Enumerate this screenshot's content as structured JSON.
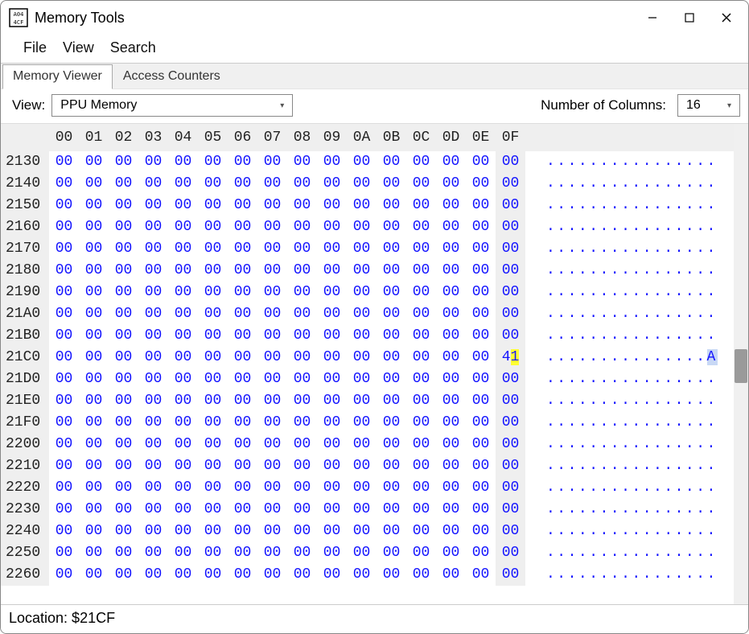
{
  "window": {
    "title": "Memory Tools"
  },
  "menubar": {
    "items": [
      "File",
      "View",
      "Search"
    ]
  },
  "tabs": {
    "items": [
      {
        "label": "Memory Viewer",
        "active": true
      },
      {
        "label": "Access Counters",
        "active": false
      }
    ]
  },
  "toolbar": {
    "view_label": "View:",
    "view_value": "PPU Memory",
    "cols_label": "Number of Columns:",
    "cols_value": "16"
  },
  "hex": {
    "col_headers": [
      "00",
      "01",
      "02",
      "03",
      "04",
      "05",
      "06",
      "07",
      "08",
      "09",
      "0A",
      "0B",
      "0C",
      "0D",
      "0E",
      "0F"
    ],
    "cursor": {
      "row_index": 9,
      "col_index": 15,
      "byte": "41",
      "sel_char_pos": 1,
      "ascii_char": "A"
    },
    "rows": [
      {
        "addr": "2130",
        "bytes": [
          "00",
          "00",
          "00",
          "00",
          "00",
          "00",
          "00",
          "00",
          "00",
          "00",
          "00",
          "00",
          "00",
          "00",
          "00",
          "00"
        ],
        "ascii": "................"
      },
      {
        "addr": "2140",
        "bytes": [
          "00",
          "00",
          "00",
          "00",
          "00",
          "00",
          "00",
          "00",
          "00",
          "00",
          "00",
          "00",
          "00",
          "00",
          "00",
          "00"
        ],
        "ascii": "................"
      },
      {
        "addr": "2150",
        "bytes": [
          "00",
          "00",
          "00",
          "00",
          "00",
          "00",
          "00",
          "00",
          "00",
          "00",
          "00",
          "00",
          "00",
          "00",
          "00",
          "00"
        ],
        "ascii": "................"
      },
      {
        "addr": "2160",
        "bytes": [
          "00",
          "00",
          "00",
          "00",
          "00",
          "00",
          "00",
          "00",
          "00",
          "00",
          "00",
          "00",
          "00",
          "00",
          "00",
          "00"
        ],
        "ascii": "................"
      },
      {
        "addr": "2170",
        "bytes": [
          "00",
          "00",
          "00",
          "00",
          "00",
          "00",
          "00",
          "00",
          "00",
          "00",
          "00",
          "00",
          "00",
          "00",
          "00",
          "00"
        ],
        "ascii": "................"
      },
      {
        "addr": "2180",
        "bytes": [
          "00",
          "00",
          "00",
          "00",
          "00",
          "00",
          "00",
          "00",
          "00",
          "00",
          "00",
          "00",
          "00",
          "00",
          "00",
          "00"
        ],
        "ascii": "................"
      },
      {
        "addr": "2190",
        "bytes": [
          "00",
          "00",
          "00",
          "00",
          "00",
          "00",
          "00",
          "00",
          "00",
          "00",
          "00",
          "00",
          "00",
          "00",
          "00",
          "00"
        ],
        "ascii": "................"
      },
      {
        "addr": "21A0",
        "bytes": [
          "00",
          "00",
          "00",
          "00",
          "00",
          "00",
          "00",
          "00",
          "00",
          "00",
          "00",
          "00",
          "00",
          "00",
          "00",
          "00"
        ],
        "ascii": "................"
      },
      {
        "addr": "21B0",
        "bytes": [
          "00",
          "00",
          "00",
          "00",
          "00",
          "00",
          "00",
          "00",
          "00",
          "00",
          "00",
          "00",
          "00",
          "00",
          "00",
          "00"
        ],
        "ascii": "................"
      },
      {
        "addr": "21C0",
        "bytes": [
          "00",
          "00",
          "00",
          "00",
          "00",
          "00",
          "00",
          "00",
          "00",
          "00",
          "00",
          "00",
          "00",
          "00",
          "00",
          "41"
        ],
        "ascii": "...............A"
      },
      {
        "addr": "21D0",
        "bytes": [
          "00",
          "00",
          "00",
          "00",
          "00",
          "00",
          "00",
          "00",
          "00",
          "00",
          "00",
          "00",
          "00",
          "00",
          "00",
          "00"
        ],
        "ascii": "................"
      },
      {
        "addr": "21E0",
        "bytes": [
          "00",
          "00",
          "00",
          "00",
          "00",
          "00",
          "00",
          "00",
          "00",
          "00",
          "00",
          "00",
          "00",
          "00",
          "00",
          "00"
        ],
        "ascii": "................"
      },
      {
        "addr": "21F0",
        "bytes": [
          "00",
          "00",
          "00",
          "00",
          "00",
          "00",
          "00",
          "00",
          "00",
          "00",
          "00",
          "00",
          "00",
          "00",
          "00",
          "00"
        ],
        "ascii": "................"
      },
      {
        "addr": "2200",
        "bytes": [
          "00",
          "00",
          "00",
          "00",
          "00",
          "00",
          "00",
          "00",
          "00",
          "00",
          "00",
          "00",
          "00",
          "00",
          "00",
          "00"
        ],
        "ascii": "................"
      },
      {
        "addr": "2210",
        "bytes": [
          "00",
          "00",
          "00",
          "00",
          "00",
          "00",
          "00",
          "00",
          "00",
          "00",
          "00",
          "00",
          "00",
          "00",
          "00",
          "00"
        ],
        "ascii": "................"
      },
      {
        "addr": "2220",
        "bytes": [
          "00",
          "00",
          "00",
          "00",
          "00",
          "00",
          "00",
          "00",
          "00",
          "00",
          "00",
          "00",
          "00",
          "00",
          "00",
          "00"
        ],
        "ascii": "................"
      },
      {
        "addr": "2230",
        "bytes": [
          "00",
          "00",
          "00",
          "00",
          "00",
          "00",
          "00",
          "00",
          "00",
          "00",
          "00",
          "00",
          "00",
          "00",
          "00",
          "00"
        ],
        "ascii": "................"
      },
      {
        "addr": "2240",
        "bytes": [
          "00",
          "00",
          "00",
          "00",
          "00",
          "00",
          "00",
          "00",
          "00",
          "00",
          "00",
          "00",
          "00",
          "00",
          "00",
          "00"
        ],
        "ascii": "................"
      },
      {
        "addr": "2250",
        "bytes": [
          "00",
          "00",
          "00",
          "00",
          "00",
          "00",
          "00",
          "00",
          "00",
          "00",
          "00",
          "00",
          "00",
          "00",
          "00",
          "00"
        ],
        "ascii": "................"
      },
      {
        "addr": "2260",
        "bytes": [
          "00",
          "00",
          "00",
          "00",
          "00",
          "00",
          "00",
          "00",
          "00",
          "00",
          "00",
          "00",
          "00",
          "00",
          "00",
          "00"
        ],
        "ascii": "................"
      }
    ]
  },
  "statusbar": {
    "location": "Location: $21CF"
  }
}
